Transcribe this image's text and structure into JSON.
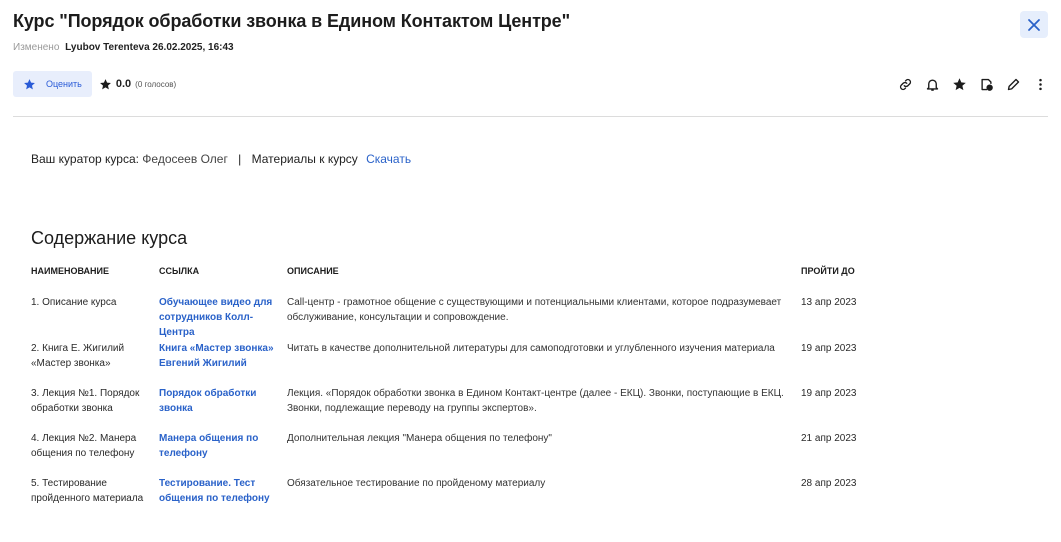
{
  "header": {
    "title": "Курс \"Порядок обработки звонка в Едином Контактом Центре\"",
    "modified_label": "Изменено",
    "modified_by": "Lyubov Terenteva 26.02.2025, 16:43"
  },
  "toolbar": {
    "rate_label": "Оценить",
    "score": "0.0",
    "votes": "(0 голосов)",
    "actions": [
      "link-icon",
      "bell-icon",
      "star-icon",
      "export-icon",
      "edit-icon",
      "more-vertical-icon"
    ]
  },
  "curator": {
    "label": "Ваш куратор курса:",
    "name": "Федосеев Олег",
    "separator": "|",
    "materials_label": "Материалы к курсу",
    "download_link": "Скачать"
  },
  "content": {
    "title": "Содержание курса",
    "columns": [
      "НАИМЕНОВАНИЕ",
      "ССЫЛКА",
      "ОПИСАНИЕ",
      "ПРОЙТИ ДО"
    ],
    "rows": [
      {
        "name": "1. Описание курса",
        "link": "Обучающее видео для сотрудников Колл-Центра",
        "description": "Call-центр - грамотное общение с существующими и потенциальными клиентами, которое подразумевает обслуживание, консультации и сопровождение.",
        "due": "13 апр 2023"
      },
      {
        "name": "2. Книга Е. Жигилий «Мастер звонка»",
        "link": "Книга «Мастер звонка» Евгений Жигилий",
        "description": "Читать в качестве дополнительной литературы для самоподготовки и углубленного изучения материала",
        "due": "19 апр 2023"
      },
      {
        "name": "3. Лекция №1. Порядок обработки звонка",
        "link": "Порядок обработки звонка",
        "description": "Лекция. «Порядок обработки звонка в Едином Контакт-центре (далее - ЕКЦ). Звонки, поступающие в ЕКЦ. Звонки, подлежащие переводу на группы экспертов».",
        "due": "19 апр 2023"
      },
      {
        "name": "4. Лекция №2. Манера общения по телефону",
        "link": "Манера общения по телефону",
        "description": "Дополнительная лекция \"Манера общения по телефону\"",
        "due": "21 апр 2023"
      },
      {
        "name": "5. Тестирование пройденного материала",
        "link": "Тестирование. Тест общения по телефону",
        "description": "Обязательное тестирование по пройденому материалу",
        "due": "28 апр 2023"
      }
    ]
  },
  "colors": {
    "accent": "#2a62c9",
    "button_bg": "#e8eefc",
    "divider": "#dcdcdc"
  }
}
